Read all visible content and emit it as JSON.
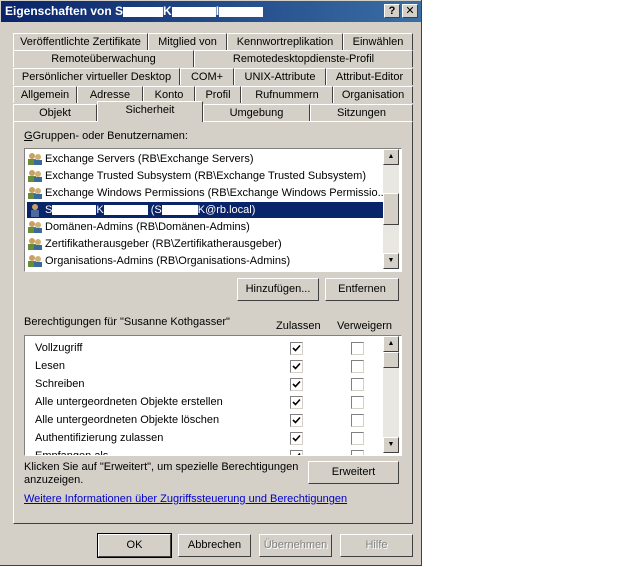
{
  "window": {
    "title_prefix": "Eigenschaften von S",
    "title_mid": "K",
    "title_end": "I",
    "help_label": "?",
    "close_label": "✕"
  },
  "tabs": {
    "row1": [
      "Veröffentlichte Zertifikate",
      "Mitglied von",
      "Kennwortreplikation",
      "Einwählen"
    ],
    "row2": [
      "Remoteüberwachung",
      "Remotedesktopdienste-Profil"
    ],
    "row3": [
      "Persönlicher virtueller Desktop",
      "COM+",
      "UNIX-Attribute",
      "Attribut-Editor"
    ],
    "row4": [
      "Allgemein",
      "Adresse",
      "Konto",
      "Profil",
      "Rufnummern",
      "Organisation"
    ],
    "row5": [
      "Objekt",
      "Sicherheit",
      "Umgebung",
      "Sitzungen"
    ]
  },
  "groups": {
    "label": "Gruppen- oder Benutzernamen:",
    "items": [
      "Exchange Servers (RB\\Exchange Servers)",
      "Exchange Trusted Subsystem (RB\\Exchange Trusted Subsystem)",
      "Exchange Windows Permissions (RB\\Exchange Windows Permissio...",
      "Domänen-Admins (RB\\Domänen-Admins)",
      "Zertifikatherausgeber (RB\\Zertifikatherausgeber)",
      "Organisations-Admins (RB\\Organisations-Admins)"
    ],
    "selected": {
      "p1": "S",
      "p2": "K",
      "p3": "(S",
      "p4": "K@rb.local)"
    }
  },
  "buttons": {
    "add": "Hinzufügen...",
    "remove": "Entfernen",
    "advanced": "Erweitert",
    "ok": "OK",
    "cancel": "Abbrechen",
    "apply": "Übernehmen",
    "help": "Hilfe"
  },
  "permissions": {
    "label": "Berechtigungen für \"Susanne Kothgasser\"",
    "allow_header": "Zulassen",
    "deny_header": "Verweigern",
    "items": [
      {
        "name": "Vollzugriff",
        "allow": true,
        "deny": false
      },
      {
        "name": "Lesen",
        "allow": true,
        "deny": false
      },
      {
        "name": "Schreiben",
        "allow": true,
        "deny": false
      },
      {
        "name": "Alle untergeordneten Objekte erstellen",
        "allow": true,
        "deny": false
      },
      {
        "name": "Alle untergeordneten Objekte löschen",
        "allow": true,
        "deny": false
      },
      {
        "name": "Authentifizierung zulassen",
        "allow": true,
        "deny": false
      },
      {
        "name": "Empfangen als",
        "allow": true,
        "deny": false
      }
    ]
  },
  "advanced_hint": {
    "line1": "Klicken Sie auf \"Erweitert\", um spezielle Berechtigungen",
    "line2": "anzuzeigen."
  },
  "more_info_link": "Weitere Informationen über Zugriffssteuerung und Berechtigungen"
}
